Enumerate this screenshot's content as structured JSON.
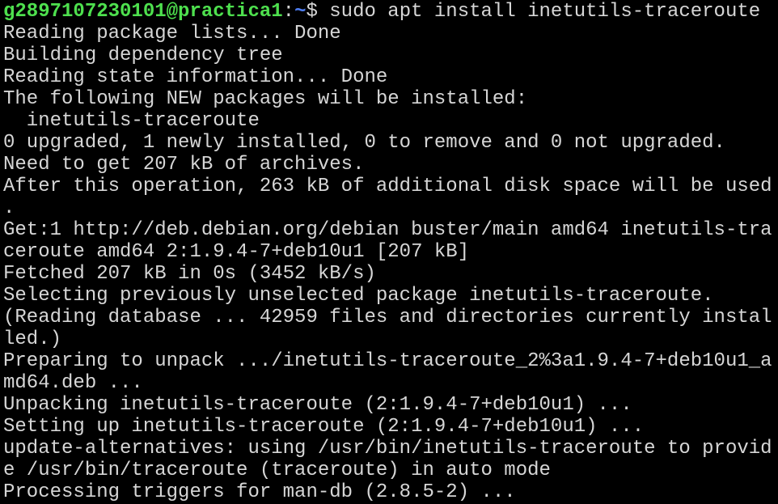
{
  "terminal": {
    "prompt": {
      "user_host": "g2897107230101@practica1",
      "separator": ":",
      "path": "~",
      "symbol": "$",
      "command": " sudo apt install inetutils-traceroute"
    },
    "output_lines": [
      "Reading package lists... Done",
      "Building dependency tree",
      "Reading state information... Done",
      "The following NEW packages will be installed:",
      "  inetutils-traceroute",
      "0 upgraded, 1 newly installed, 0 to remove and 0 not upgraded.",
      "Need to get 207 kB of archives.",
      "After this operation, 263 kB of additional disk space will be used",
      ".",
      "Get:1 http://deb.debian.org/debian buster/main amd64 inetutils-tra",
      "ceroute amd64 2:1.9.4-7+deb10u1 [207 kB]",
      "Fetched 207 kB in 0s (3452 kB/s)",
      "Selecting previously unselected package inetutils-traceroute.",
      "(Reading database ... 42959 files and directories currently instal",
      "led.)",
      "Preparing to unpack .../inetutils-traceroute_2%3a1.9.4-7+deb10u1_a",
      "md64.deb ...",
      "Unpacking inetutils-traceroute (2:1.9.4-7+deb10u1) ...",
      "Setting up inetutils-traceroute (2:1.9.4-7+deb10u1) ...",
      "update-alternatives: using /usr/bin/inetutils-traceroute to provid",
      "e /usr/bin/traceroute (traceroute) in auto mode",
      "Processing triggers for man-db (2.8.5-2) ..."
    ]
  }
}
